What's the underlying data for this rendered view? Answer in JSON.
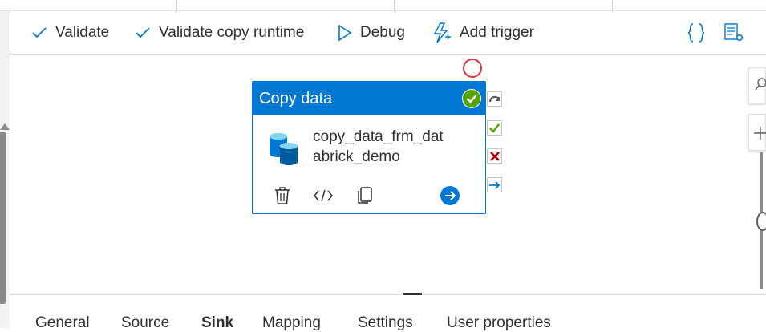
{
  "toolbar": {
    "validate_label": "Validate",
    "validate_runtime_label": "Validate copy runtime",
    "debug_label": "Debug",
    "add_trigger_label": "Add trigger"
  },
  "activity": {
    "type_label": "Copy data",
    "name_line1": "copy_data_frm_dat",
    "name_line2": "abrick_demo",
    "status": "succeeded"
  },
  "bottom_tabs": [
    "General",
    "Source",
    "Sink",
    "Mapping",
    "Settings",
    "User properties"
  ],
  "active_tab": "Sink",
  "colors": {
    "accent": "#0078d4",
    "success": "#57a300",
    "failure": "#a80000",
    "validation_error": "#d13438"
  }
}
